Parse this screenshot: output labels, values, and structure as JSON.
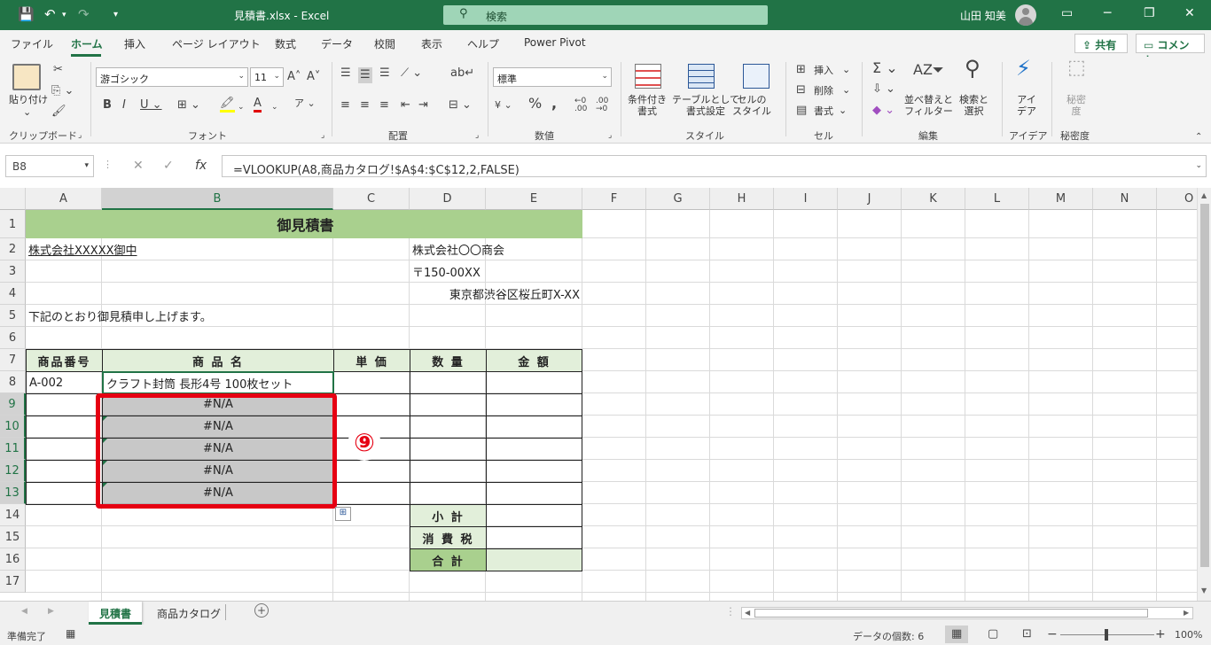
{
  "title_bar": {
    "document_title": "見積書.xlsx  -  Excel",
    "search_placeholder": "検索",
    "user_name": "山田 知美"
  },
  "menu": {
    "tabs": [
      "ファイル",
      "ホーム",
      "挿入",
      "ページ レイアウト",
      "数式",
      "データ",
      "校閲",
      "表示",
      "ヘルプ",
      "Power Pivot"
    ],
    "active_tab": "ホーム",
    "share_label": "共有",
    "comment_label": "コメント"
  },
  "ribbon": {
    "clipboard": {
      "paste": "貼り付け",
      "group": "クリップボード"
    },
    "font": {
      "name": "游ゴシック",
      "size": "11",
      "group": "フォント"
    },
    "alignment": {
      "group": "配置"
    },
    "number": {
      "format": "標準",
      "group": "数値"
    },
    "styles": {
      "conditional": "条件付き\n書式",
      "table": "テーブルとして\n書式設定",
      "cell": "セルの\nスタイル",
      "group": "スタイル"
    },
    "cells": {
      "insert": "挿入",
      "delete": "削除",
      "format": "書式",
      "group": "セル"
    },
    "editing": {
      "sort": "並べ替えと\nフィルター",
      "find": "検索と\n選択",
      "group": "編集"
    },
    "ideas": {
      "label": "アイ\nデア",
      "group": "アイデア"
    },
    "sensitivity": {
      "label": "秘密\n度",
      "group": "秘密度"
    }
  },
  "formula_bar": {
    "name_box": "B8",
    "formula": "=VLOOKUP(A8,商品カタログ!$A$4:$C$12,2,FALSE)"
  },
  "grid": {
    "columns": [
      "A",
      "B",
      "C",
      "D",
      "E",
      "F",
      "G",
      "H",
      "I",
      "J",
      "K",
      "L",
      "M",
      "N",
      "O"
    ],
    "rows": [
      "1",
      "2",
      "3",
      "4",
      "5",
      "6",
      "7",
      "8",
      "9",
      "10",
      "11",
      "12",
      "13",
      "14",
      "15",
      "16",
      "17"
    ],
    "selected_column": "B"
  },
  "cells": {
    "title": "御見積書",
    "client": "株式会社XXXXX御中",
    "company": "株式会社〇〇商会",
    "postal": "〒150-00XX",
    "address": "東京都渋谷区桜丘町X-XX",
    "greeting": "下記のとおり御見積申し上げます。",
    "headers": [
      "商品番号",
      "商 品 名",
      "単 価",
      "数 量",
      "金 額"
    ],
    "a8": "A-002",
    "b8": "クラフト封筒 長形4号 100枚セット",
    "na_values": [
      "#N/A",
      "#N/A",
      "#N/A",
      "#N/A",
      "#N/A"
    ],
    "subtotal": "小 計",
    "tax": "消 費 税",
    "total": "合 計"
  },
  "annotation": {
    "step": "⑨",
    "color": "#e60012"
  },
  "sheet_tabs": [
    "見積書",
    "商品カタログ"
  ],
  "active_sheet": "見積書",
  "status": {
    "ready": "準備完了",
    "count": "データの個数: 6",
    "zoom": "100%"
  },
  "colors": {
    "excel_green": "#217346",
    "header_fill": "#e2efda",
    "title_fill": "#a9d08e",
    "total_fill": "#a9d08e",
    "na_fill": "#c8c8c8"
  }
}
